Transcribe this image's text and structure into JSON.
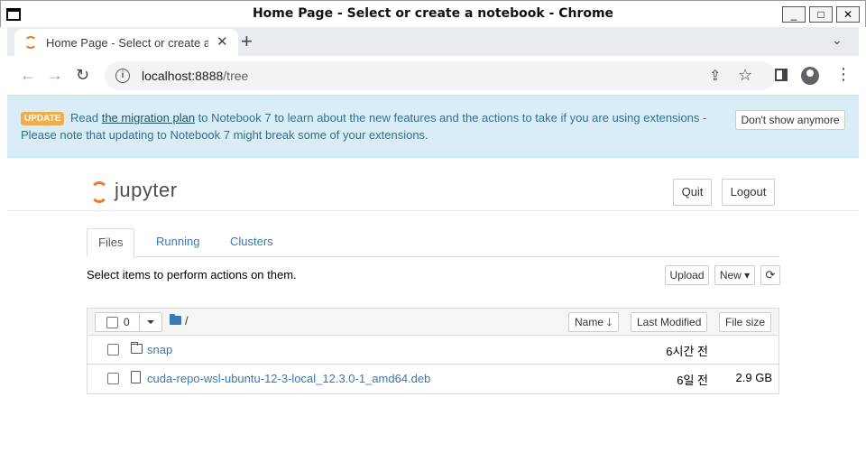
{
  "window": {
    "title": "Home Page - Select or create a notebook - Chrome",
    "minimize": "_",
    "maximize": "□",
    "close": "✕"
  },
  "browser": {
    "tab_title": "Home Page - Select or create a notebook",
    "tab_close": "✕",
    "new_tab": "+",
    "tab_menu": "⌄",
    "url_host": "localhost:8888",
    "url_path": "/tree",
    "back": "←",
    "forward": "→",
    "reload": "↻",
    "menu": "⋮"
  },
  "banner": {
    "badge": "UPDATE",
    "pre": "Read ",
    "link": "the migration plan",
    "post": " to Notebook 7 to learn about the new features and the actions to take if you are using extensions - Please note that updating to Notebook 7 might break some of your extensions.",
    "dismiss": "Don't show anymore",
    "bg_color": "#d9edf7"
  },
  "header": {
    "logo_text": "jupyter",
    "quit": "Quit",
    "logout": "Logout"
  },
  "tabs": {
    "files": "Files",
    "running": "Running",
    "clusters": "Clusters"
  },
  "toolbar": {
    "hint": "Select items to perform actions on them.",
    "upload": "Upload",
    "new": "New ▾",
    "refresh": "⟳"
  },
  "list": {
    "selected_count": "0",
    "breadcrumb": "/",
    "sort_name": "Name 🡓",
    "sort_modified": "Last Modified",
    "sort_size": "File size",
    "rows": [
      {
        "name": "snap",
        "type": "folder",
        "modified": "6시간 전",
        "size": ""
      },
      {
        "name": "cuda-repo-wsl-ubuntu-12-3-local_12.3.0-1_amd64.deb",
        "type": "file",
        "modified": "6일 전",
        "size": "2.9 GB"
      }
    ]
  },
  "colors": {
    "accent": "#f37726",
    "link": "#337ab7"
  }
}
